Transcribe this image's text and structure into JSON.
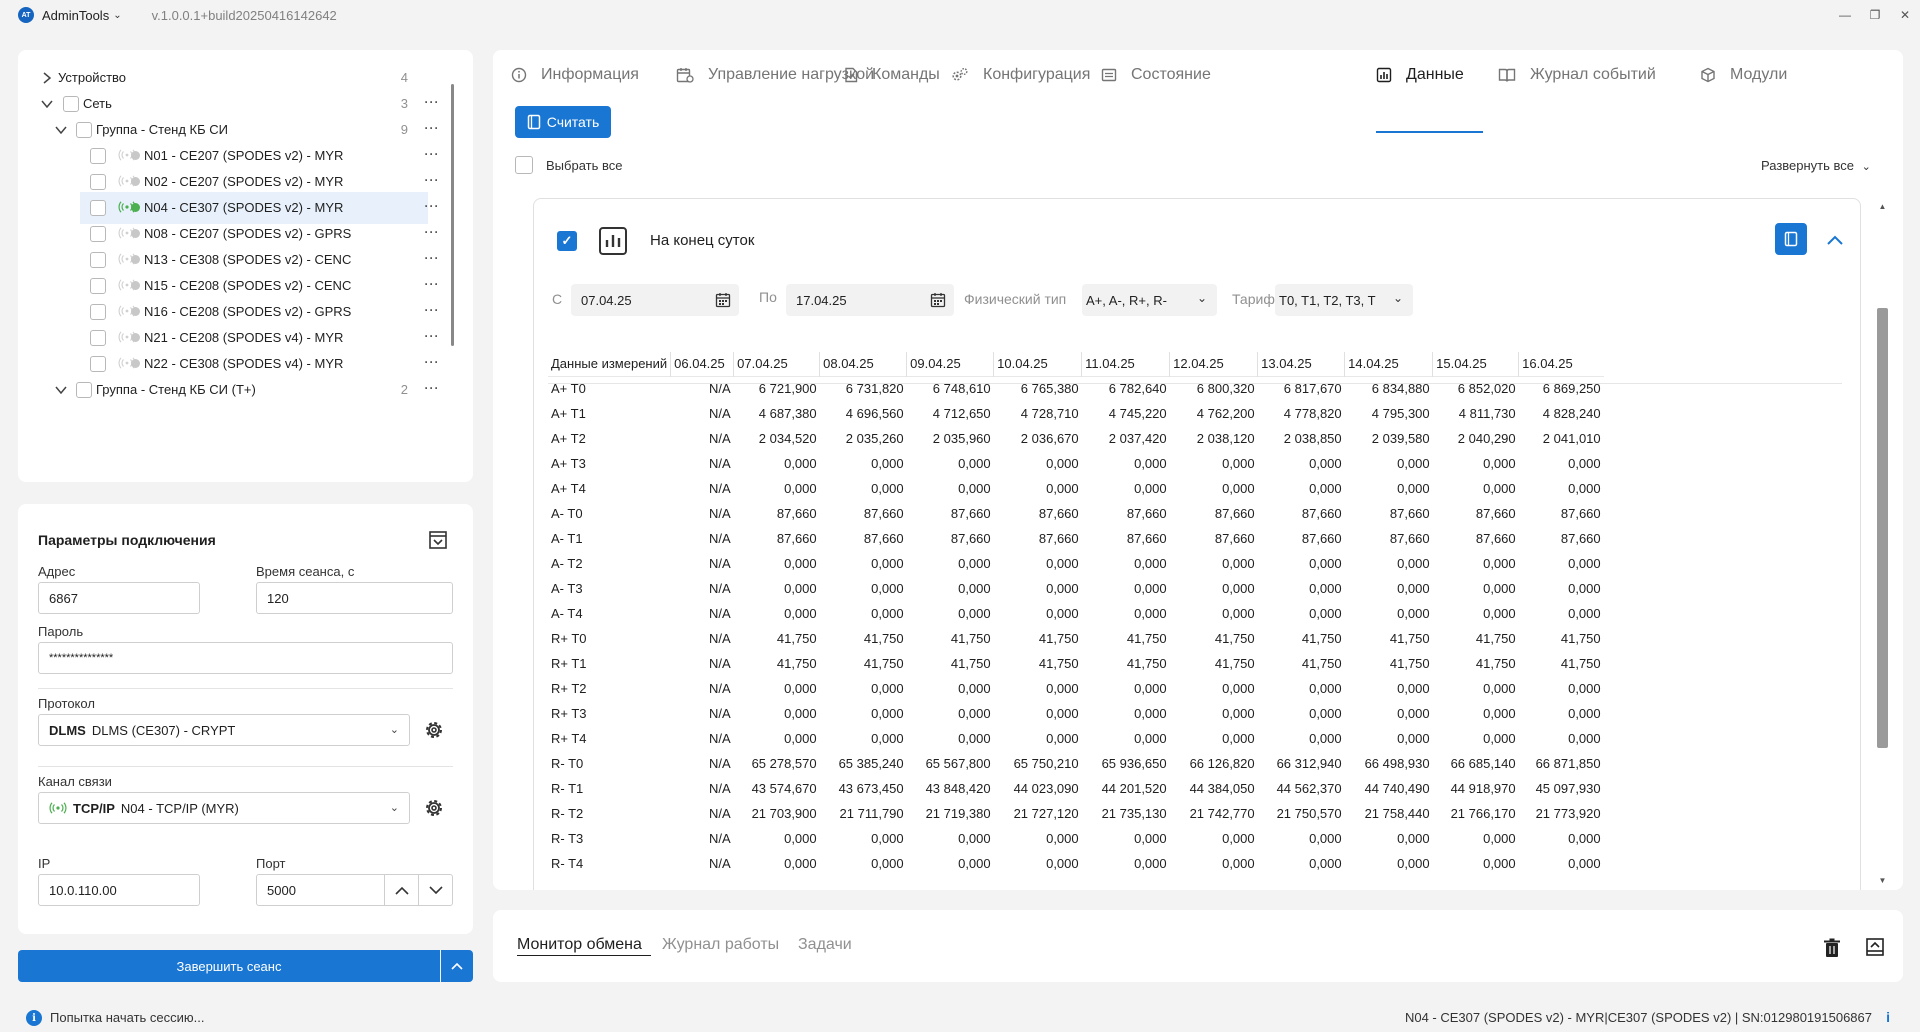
{
  "titlebar": {
    "app_name": "AdminTools",
    "version": "v.1.0.0.1+build20250416142642",
    "logo_text": "AT"
  },
  "tree": {
    "items": [
      {
        "label": "Устройство",
        "count": "4",
        "more": ""
      },
      {
        "label": "Сеть",
        "count": "3",
        "more": "···"
      },
      {
        "label": "Группа - Стенд КБ СИ",
        "count": "9",
        "more": "···"
      },
      {
        "label": "N01 - CE207 (SPODES v2) - MYR",
        "count": "",
        "more": "···"
      },
      {
        "label": "N02 - CE207 (SPODES v2) - MYR",
        "count": "",
        "more": "···"
      },
      {
        "label": "N04 - CE307 (SPODES v2) - MYR",
        "count": "",
        "more": "···"
      },
      {
        "label": "N08 - CE207 (SPODES v2) - GPRS",
        "count": "",
        "more": "···"
      },
      {
        "label": "N13 - CE308 (SPODES v2) - CENC",
        "count": "",
        "more": "···"
      },
      {
        "label": "N15 - CE208 (SPODES v2) - CENC",
        "count": "",
        "more": "···"
      },
      {
        "label": "N16 - CE208 (SPODES v2) - GPRS",
        "count": "",
        "more": "···"
      },
      {
        "label": "N21 - CE208 (SPODES v4) - MYR",
        "count": "",
        "more": "···"
      },
      {
        "label": "N22 - CE308 (SPODES v4) - MYR",
        "count": "",
        "more": "···"
      },
      {
        "label": "Группа - Стенд КБ СИ (Т+)",
        "count": "2",
        "more": "···"
      }
    ]
  },
  "params": {
    "title": "Параметры подключения",
    "address_label": "Адрес",
    "address_value": "6867",
    "session_label": "Время сеанса, с",
    "session_value": "120",
    "password_label": "Пароль",
    "password_value": "***************",
    "protocol_label": "Протокол",
    "protocol_bold": "DLMS",
    "protocol_value": "DLMS (CE307) - CRYPT",
    "channel_label": "Канал связи",
    "channel_bold": "TCP/IP",
    "channel_value": "N04 - TCP/IP (MYR)",
    "ip_label": "IP",
    "ip_value": "10.0.110.00",
    "port_label": "Порт",
    "port_value": "5000",
    "end_session": "Завершить сеанс"
  },
  "status": {
    "left_text": "Попытка начать сессию...",
    "right_text": "N04 - CE307 (SPODES v2) - MYR|CE307 (SPODES v2) | SN:012980191506867",
    "info_glyph": "i",
    "right_glyph": "i"
  },
  "tabs": [
    {
      "label": "Информация",
      "icon": "info-icon"
    },
    {
      "label": "Управление нагрузкой",
      "icon": "calendar-load-icon"
    },
    {
      "label": "Команды",
      "icon": "document-check-icon"
    },
    {
      "label": "Конфигурация",
      "icon": "gears-icon"
    },
    {
      "label": "Состояние",
      "icon": "state-icon"
    },
    {
      "label": "Данные",
      "icon": "data-chart-icon"
    },
    {
      "label": "Журнал событий",
      "icon": "journal-icon"
    },
    {
      "label": "Модули",
      "icon": "cube-icon"
    }
  ],
  "toolbar": {
    "read_label": "Считать",
    "select_all": "Выбрать все",
    "expand_all": "Развернуть все"
  },
  "section": {
    "title": "На конец суток",
    "from_label": "С",
    "from_value": "07.04.25",
    "to_label": "По",
    "to_value": "17.04.25",
    "phys_label": "Физический тип",
    "phys_value": "A+, A-, R+, R-",
    "tariff_label": "Тариф",
    "tariff_value": "T0, T1, T2, T3, T"
  },
  "table": {
    "headers": [
      "Данные измерений",
      "06.04.25",
      "07.04.25",
      "08.04.25",
      "09.04.25",
      "10.04.25",
      "11.04.25",
      "12.04.25",
      "13.04.25",
      "14.04.25",
      "15.04.25",
      "16.04.25"
    ],
    "rows": [
      [
        "A+ T0",
        "N/A",
        "6 721,900",
        "6 731,820",
        "6 748,610",
        "6 765,380",
        "6 782,640",
        "6 800,320",
        "6 817,670",
        "6 834,880",
        "6 852,020",
        "6 869,250"
      ],
      [
        "A+ T1",
        "N/A",
        "4 687,380",
        "4 696,560",
        "4 712,650",
        "4 728,710",
        "4 745,220",
        "4 762,200",
        "4 778,820",
        "4 795,300",
        "4 811,730",
        "4 828,240"
      ],
      [
        "A+ T2",
        "N/A",
        "2 034,520",
        "2 035,260",
        "2 035,960",
        "2 036,670",
        "2 037,420",
        "2 038,120",
        "2 038,850",
        "2 039,580",
        "2 040,290",
        "2 041,010"
      ],
      [
        "A+ T3",
        "N/A",
        "0,000",
        "0,000",
        "0,000",
        "0,000",
        "0,000",
        "0,000",
        "0,000",
        "0,000",
        "0,000",
        "0,000"
      ],
      [
        "A+ T4",
        "N/A",
        "0,000",
        "0,000",
        "0,000",
        "0,000",
        "0,000",
        "0,000",
        "0,000",
        "0,000",
        "0,000",
        "0,000"
      ],
      [
        "A- T0",
        "N/A",
        "87,660",
        "87,660",
        "87,660",
        "87,660",
        "87,660",
        "87,660",
        "87,660",
        "87,660",
        "87,660",
        "87,660"
      ],
      [
        "A- T1",
        "N/A",
        "87,660",
        "87,660",
        "87,660",
        "87,660",
        "87,660",
        "87,660",
        "87,660",
        "87,660",
        "87,660",
        "87,660"
      ],
      [
        "A- T2",
        "N/A",
        "0,000",
        "0,000",
        "0,000",
        "0,000",
        "0,000",
        "0,000",
        "0,000",
        "0,000",
        "0,000",
        "0,000"
      ],
      [
        "A- T3",
        "N/A",
        "0,000",
        "0,000",
        "0,000",
        "0,000",
        "0,000",
        "0,000",
        "0,000",
        "0,000",
        "0,000",
        "0,000"
      ],
      [
        "A- T4",
        "N/A",
        "0,000",
        "0,000",
        "0,000",
        "0,000",
        "0,000",
        "0,000",
        "0,000",
        "0,000",
        "0,000",
        "0,000"
      ],
      [
        "R+ T0",
        "N/A",
        "41,750",
        "41,750",
        "41,750",
        "41,750",
        "41,750",
        "41,750",
        "41,750",
        "41,750",
        "41,750",
        "41,750"
      ],
      [
        "R+ T1",
        "N/A",
        "41,750",
        "41,750",
        "41,750",
        "41,750",
        "41,750",
        "41,750",
        "41,750",
        "41,750",
        "41,750",
        "41,750"
      ],
      [
        "R+ T2",
        "N/A",
        "0,000",
        "0,000",
        "0,000",
        "0,000",
        "0,000",
        "0,000",
        "0,000",
        "0,000",
        "0,000",
        "0,000"
      ],
      [
        "R+ T3",
        "N/A",
        "0,000",
        "0,000",
        "0,000",
        "0,000",
        "0,000",
        "0,000",
        "0,000",
        "0,000",
        "0,000",
        "0,000"
      ],
      [
        "R+ T4",
        "N/A",
        "0,000",
        "0,000",
        "0,000",
        "0,000",
        "0,000",
        "0,000",
        "0,000",
        "0,000",
        "0,000",
        "0,000"
      ],
      [
        "R- T0",
        "N/A",
        "65 278,570",
        "65 385,240",
        "65 567,800",
        "65 750,210",
        "65 936,650",
        "66 126,820",
        "66 312,940",
        "66 498,930",
        "66 685,140",
        "66 871,850"
      ],
      [
        "R- T1",
        "N/A",
        "43 574,670",
        "43 673,450",
        "43 848,420",
        "44 023,090",
        "44 201,520",
        "44 384,050",
        "44 562,370",
        "44 740,490",
        "44 918,970",
        "45 097,930"
      ],
      [
        "R- T2",
        "N/A",
        "21 703,900",
        "21 711,790",
        "21 719,380",
        "21 727,120",
        "21 735,130",
        "21 742,770",
        "21 750,570",
        "21 758,440",
        "21 766,170",
        "21 773,920"
      ],
      [
        "R- T3",
        "N/A",
        "0,000",
        "0,000",
        "0,000",
        "0,000",
        "0,000",
        "0,000",
        "0,000",
        "0,000",
        "0,000",
        "0,000"
      ],
      [
        "R- T4",
        "N/A",
        "0,000",
        "0,000",
        "0,000",
        "0,000",
        "0,000",
        "0,000",
        "0,000",
        "0,000",
        "0,000",
        "0,000"
      ]
    ]
  },
  "bottom_tabs": [
    "Монитор обмена",
    "Журнал работы",
    "Задачи"
  ],
  "colors": {
    "accent": "#1976d2",
    "online": "#4caf50",
    "offline": "#c8c8c8"
  }
}
